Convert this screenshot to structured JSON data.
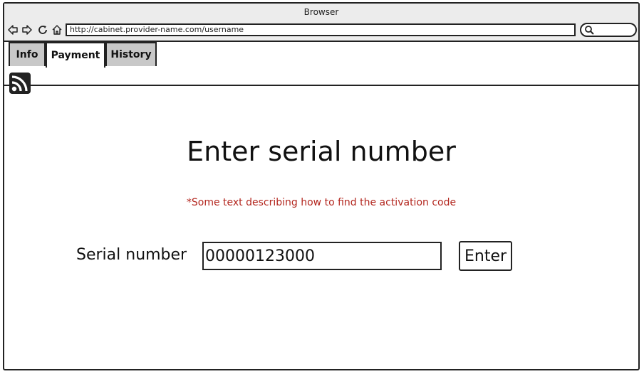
{
  "window": {
    "title": "Browser"
  },
  "toolbar": {
    "url": "http://cabinet.provider-name.com/username",
    "icons": [
      "back-arrow-icon",
      "forward-arrow-icon",
      "reload-icon",
      "home-icon",
      "search-icon"
    ]
  },
  "tabs": [
    {
      "label": "Info",
      "active": false
    },
    {
      "label": "Payment",
      "active": true
    },
    {
      "label": "History",
      "active": false
    }
  ],
  "page": {
    "feed_icon": "rss-icon",
    "title": "Enter serial number",
    "hint": "*Some text describing how to find the activation code",
    "hint_color": "#b3261e",
    "serial_label": "Serial number",
    "serial_value": "00000123000",
    "enter_label": "Enter"
  }
}
